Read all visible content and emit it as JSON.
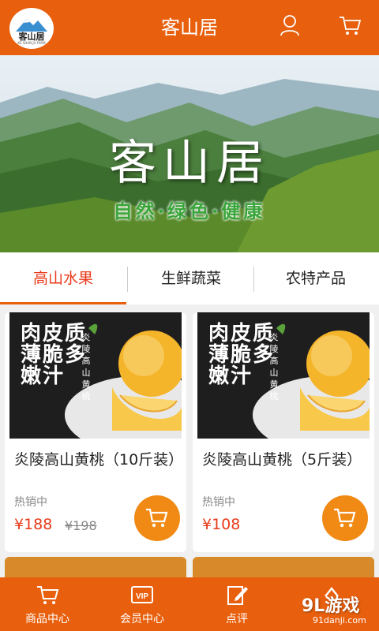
{
  "app": {
    "title": "客山居",
    "logo_text": "客山居",
    "logo_sub": "KE SHAN JU FARM"
  },
  "banner": {
    "title": "客山居",
    "slogan": "自然·绿色·健康",
    "slide_count": 2,
    "active_slide": 2
  },
  "tabs": [
    {
      "label": "高山水果",
      "active": true
    },
    {
      "label": "生鲜蔬菜",
      "active": false
    },
    {
      "label": "农特产品",
      "active": false
    }
  ],
  "products": [
    {
      "name": "炎陵高山黄桃（10斤装）",
      "status": "热销中",
      "price": "¥188",
      "original_price": "¥198",
      "img_text": "肉皮质薄脆多嫩汁",
      "img_vert_text": "炎陵高山黄桃"
    },
    {
      "name": "炎陵高山黄桃（5斤装）",
      "status": "热销中",
      "price": "¥108",
      "original_price": "",
      "img_text": "肉皮质薄脆多嫩汁",
      "img_vert_text": "炎陵高山黄桃"
    }
  ],
  "bottom_nav": [
    {
      "label": "商品中心",
      "icon": "cart-icon"
    },
    {
      "label": "会员中心",
      "icon": "vip-icon"
    },
    {
      "label": "点评",
      "icon": "edit-icon"
    },
    {
      "label": "",
      "icon": "up-arrow-icon"
    }
  ],
  "watermark": {
    "main": "9L游戏",
    "sub": "91danji.com"
  },
  "colors": {
    "brand": "#e8600e",
    "accent_red": "#e83a1a",
    "cart_orange": "#f08a14"
  }
}
